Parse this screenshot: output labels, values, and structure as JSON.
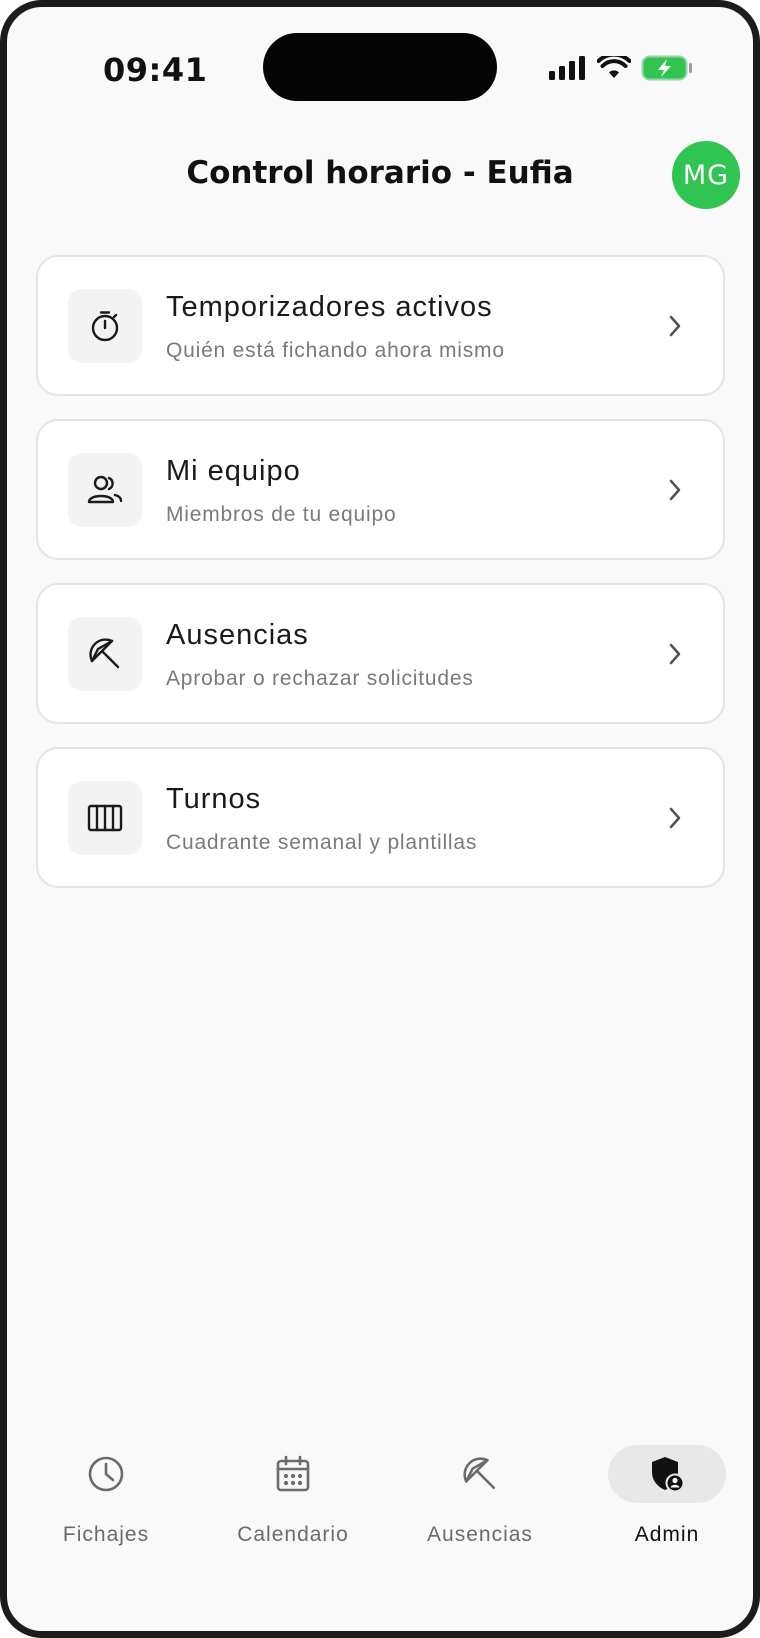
{
  "status_bar": {
    "time": "09:41",
    "icons": [
      "signal-icon",
      "wifi-icon",
      "battery-charging-icon"
    ]
  },
  "header": {
    "title": "Control horario - Eufia",
    "avatar_initials": "MG",
    "avatar_color": "#30c552"
  },
  "menu": [
    {
      "title": "Temporizadores activos",
      "subtitle": "Quién está fichando ahora mismo",
      "icon": "stopwatch-icon"
    },
    {
      "title": "Mi equipo",
      "subtitle": "Miembros de tu equipo",
      "icon": "team-icon"
    },
    {
      "title": "Ausencias",
      "subtitle": "Aprobar o rechazar solicitudes",
      "icon": "umbrella-icon"
    },
    {
      "title": "Turnos",
      "subtitle": "Cuadrante semanal y plantillas",
      "icon": "shifts-icon"
    }
  ],
  "tabbar": {
    "active": "Admin",
    "tabs": [
      {
        "label": "Fichajes",
        "icon": "clock-icon"
      },
      {
        "label": "Calendario",
        "icon": "calendar-icon"
      },
      {
        "label": "Ausencias",
        "icon": "umbrella-icon"
      },
      {
        "label": "Admin",
        "icon": "admin-shield-icon"
      }
    ]
  }
}
